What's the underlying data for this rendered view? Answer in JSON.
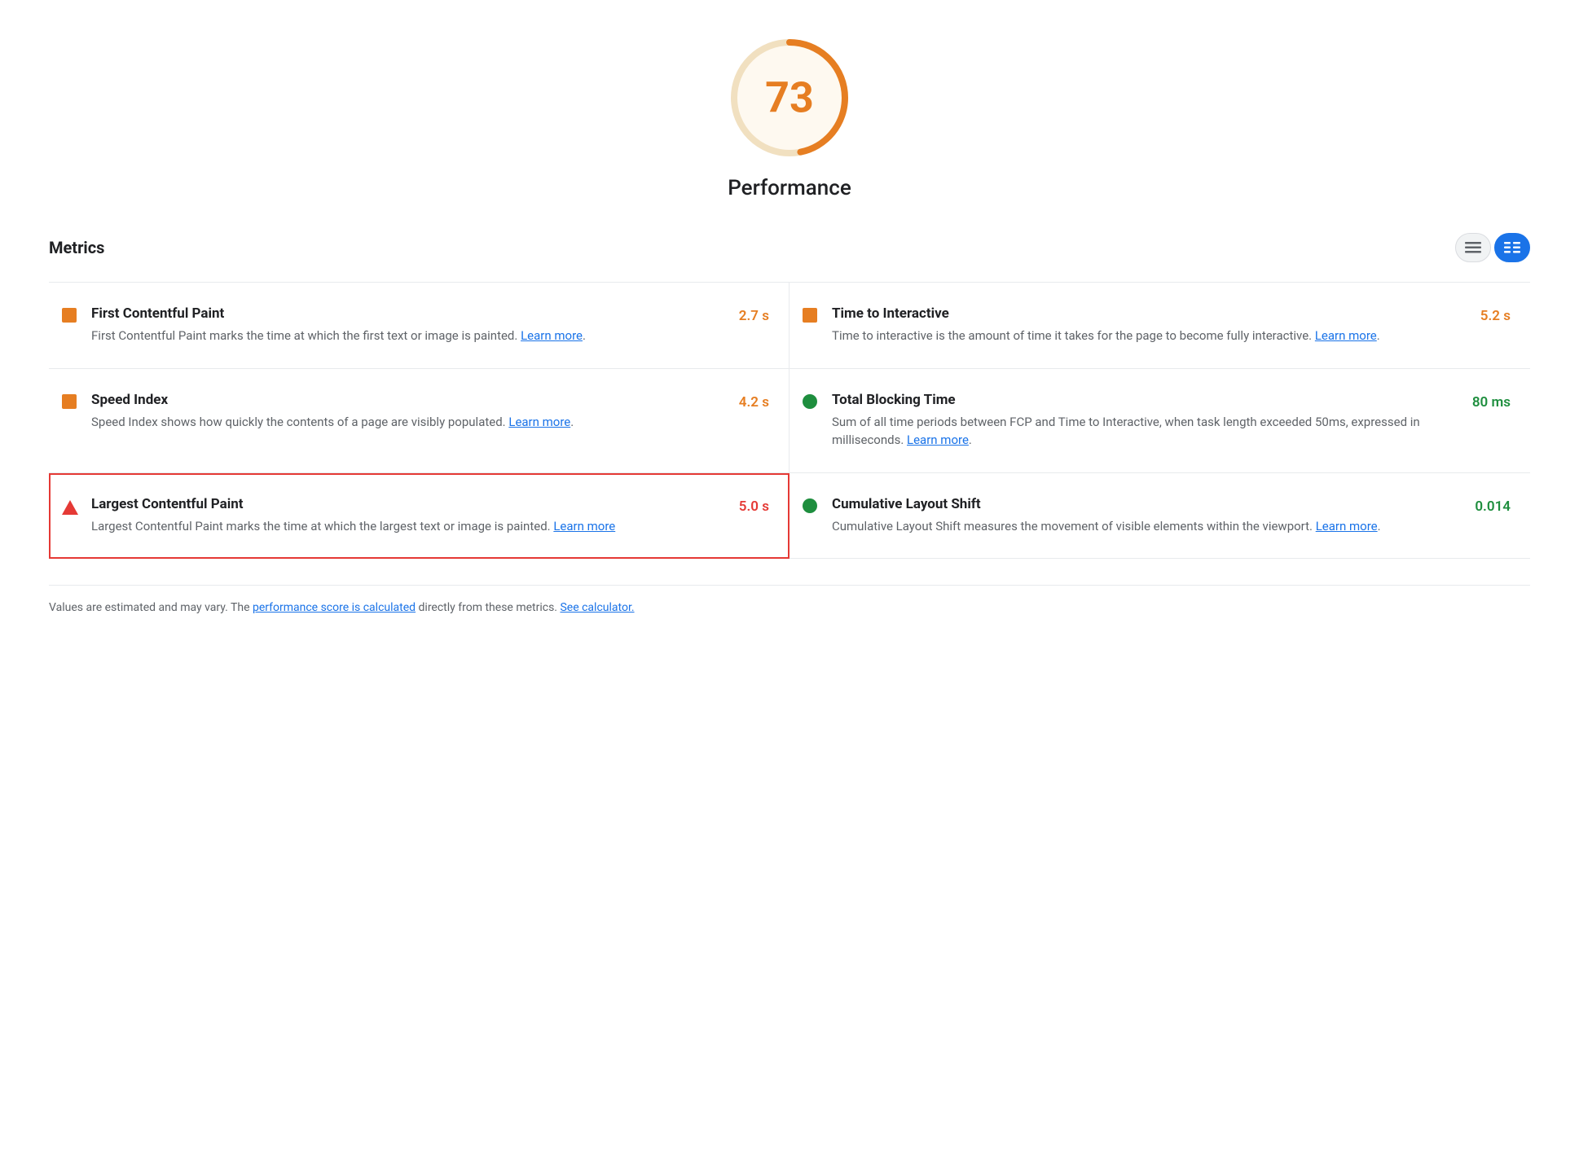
{
  "score": {
    "value": "73",
    "label": "Performance",
    "color": "#e67e22",
    "bg_color": "#fef9f0"
  },
  "metrics_section": {
    "title": "Metrics",
    "toggle": {
      "list_icon": "list-icon",
      "detail_icon": "detail-icon"
    }
  },
  "metrics": [
    {
      "id": "fcp",
      "name": "First Contentful Paint",
      "description": "First Contentful Paint marks the time at which the first text or image is painted.",
      "learn_more": "Learn more",
      "value": "2.7 s",
      "value_class": "value-orange",
      "icon_type": "square",
      "icon_class": "icon-orange",
      "highlighted": false,
      "col": "left"
    },
    {
      "id": "tti",
      "name": "Time to Interactive",
      "description": "Time to interactive is the amount of time it takes for the page to become fully interactive.",
      "learn_more": "Learn more",
      "value": "5.2 s",
      "value_class": "value-orange",
      "icon_type": "square",
      "icon_class": "icon-orange",
      "highlighted": false,
      "col": "right"
    },
    {
      "id": "si",
      "name": "Speed Index",
      "description": "Speed Index shows how quickly the contents of a page are visibly populated.",
      "learn_more": "Learn more",
      "value": "4.2 s",
      "value_class": "value-orange",
      "icon_type": "square",
      "icon_class": "icon-orange",
      "highlighted": false,
      "col": "left"
    },
    {
      "id": "tbt",
      "name": "Total Blocking Time",
      "description": "Sum of all time periods between FCP and Time to Interactive, when task length exceeded 50ms, expressed in milliseconds.",
      "learn_more": "Learn more",
      "value": "80 ms",
      "value_class": "value-green",
      "icon_type": "circle",
      "icon_class": "icon-green",
      "highlighted": false,
      "col": "right"
    },
    {
      "id": "lcp",
      "name": "Largest Contentful Paint",
      "description": "Largest Contentful Paint marks the time at which the largest text or image is painted.",
      "learn_more": "Learn more",
      "value": "5.0 s",
      "value_class": "value-red",
      "icon_type": "triangle",
      "icon_class": "",
      "highlighted": true,
      "col": "left"
    },
    {
      "id": "cls",
      "name": "Cumulative Layout Shift",
      "description": "Cumulative Layout Shift measures the movement of visible elements within the viewport.",
      "learn_more": "Learn more",
      "value": "0.014",
      "value_class": "value-green",
      "icon_type": "circle",
      "icon_class": "icon-green",
      "highlighted": false,
      "col": "right"
    }
  ],
  "footer": {
    "text_before": "Values are estimated and may vary. The ",
    "link1_text": "performance score is calculated",
    "text_middle": " directly from these metrics. ",
    "link2_text": "See calculator.",
    "text_after": ""
  }
}
